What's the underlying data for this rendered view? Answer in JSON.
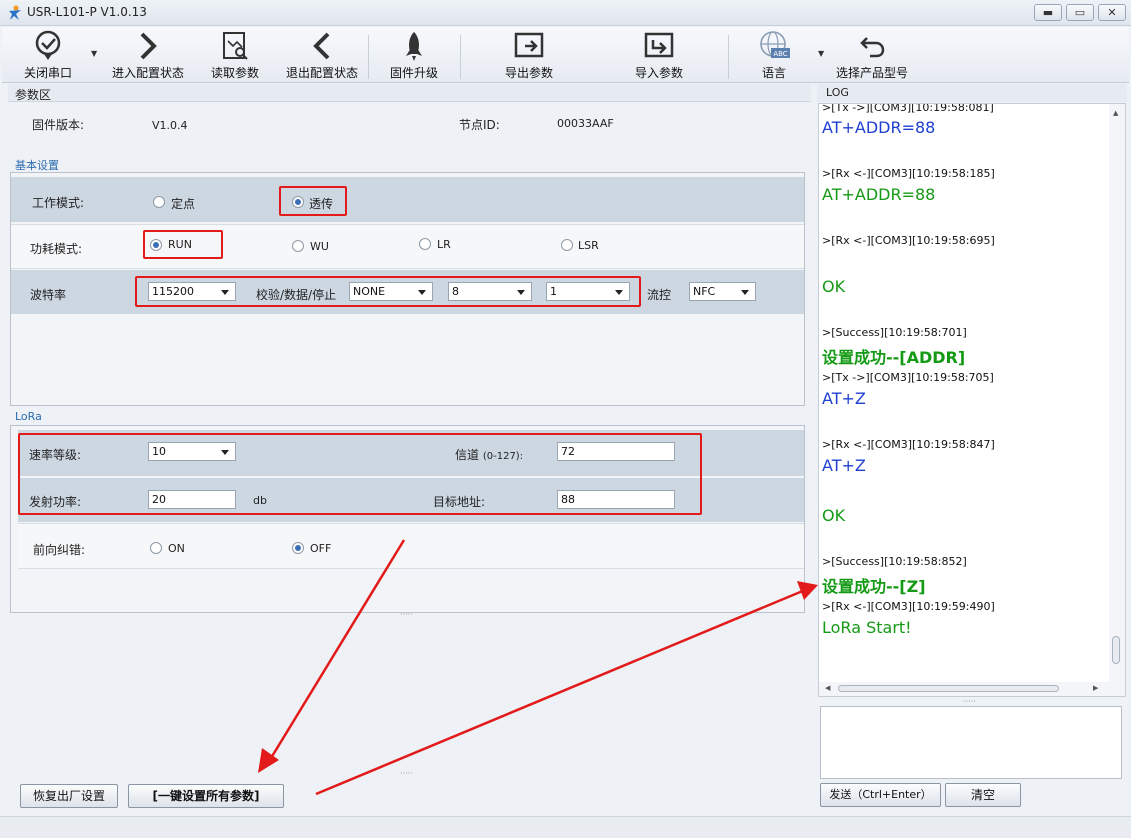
{
  "window": {
    "title": "USR-L101-P V1.0.13",
    "controls": {
      "minimize": "▬",
      "maximize": "▭",
      "close": "✕"
    }
  },
  "toolbar": {
    "close_port": "关闭串口",
    "enter_config": "进入配置状态",
    "read_params": "读取参数",
    "exit_config": "退出配置状态",
    "firmware_upgrade": "固件升级",
    "export_params": "导出参数",
    "import_params": "导入参数",
    "language": "语言",
    "language_icon_text": "ABC",
    "select_model": "选择产品型号"
  },
  "params": {
    "section_title": "参数区",
    "firmware_label": "固件版本:",
    "firmware_value": "V1.0.4",
    "node_id_label": "节点ID:",
    "node_id_value": "00033AAF"
  },
  "basic": {
    "title": "基本设置",
    "work_mode_label": "工作模式:",
    "work_mode_options": [
      "定点",
      "透传"
    ],
    "work_mode_selected": "透传",
    "power_mode_label": "功耗模式:",
    "power_mode_options": [
      "RUN",
      "WU",
      "LR",
      "LSR"
    ],
    "power_mode_selected": "RUN",
    "baud_label": "波特率",
    "baud_value": "115200",
    "parity_label": "校验/数据/停止",
    "parity_value": "NONE",
    "data_bits_value": "8",
    "stop_bits_value": "1",
    "flow_label": "流控",
    "flow_value": "NFC"
  },
  "lora": {
    "title": "LoRa",
    "rate_label": "速率等级:",
    "rate_value": "10",
    "channel_label": "信道",
    "channel_range": "(0-127):",
    "channel_value": "72",
    "power_label": "发射功率:",
    "power_value": "20",
    "power_unit": "db",
    "target_label": "目标地址:",
    "target_value": "88",
    "fec_label": "前向纠错:",
    "fec_options": [
      "ON",
      "OFF"
    ],
    "fec_selected": "OFF"
  },
  "bottom": {
    "restore_button": "恢复出厂设置",
    "set_all_button": "[一键设置所有参数]"
  },
  "log": {
    "title": "LOG",
    "entries": [
      {
        "kind": "meta",
        "text": ">[Tx ->][COM3][10:19:58:081]"
      },
      {
        "kind": "blue",
        "text": "AT+ADDR=88"
      },
      {
        "kind": "meta",
        "text": ">[Rx <-][COM3][10:19:58:185]"
      },
      {
        "kind": "green",
        "text": "AT+ADDR=88"
      },
      {
        "kind": "meta",
        "text": ">[Rx <-][COM3][10:19:58:695]"
      },
      {
        "kind": "green",
        "text": "OK"
      },
      {
        "kind": "meta",
        "text": ">[Success][10:19:58:701]"
      },
      {
        "kind": "green-bold",
        "text": "设置成功--[ADDR]"
      },
      {
        "kind": "meta",
        "text": ">[Tx ->][COM3][10:19:58:705]"
      },
      {
        "kind": "blue",
        "text": "AT+Z"
      },
      {
        "kind": "meta",
        "text": ">[Rx <-][COM3][10:19:58:847]"
      },
      {
        "kind": "blue",
        "text": "AT+Z"
      },
      {
        "kind": "green",
        "text": "OK"
      },
      {
        "kind": "meta",
        "text": ">[Success][10:19:58:852]"
      },
      {
        "kind": "green-bold",
        "text": "设置成功--[Z]"
      },
      {
        "kind": "meta",
        "text": ">[Rx <-][COM3][10:19:59:490]"
      },
      {
        "kind": "green",
        "text": "LoRa Start!"
      }
    ],
    "send_button": "发送（Ctrl+Enter）",
    "clear_button": "清空"
  },
  "colors": {
    "highlight_red": "#e21a1a",
    "log_blue": "#1f3fd2",
    "log_green": "#159a15",
    "band": "#cdd7e2"
  }
}
